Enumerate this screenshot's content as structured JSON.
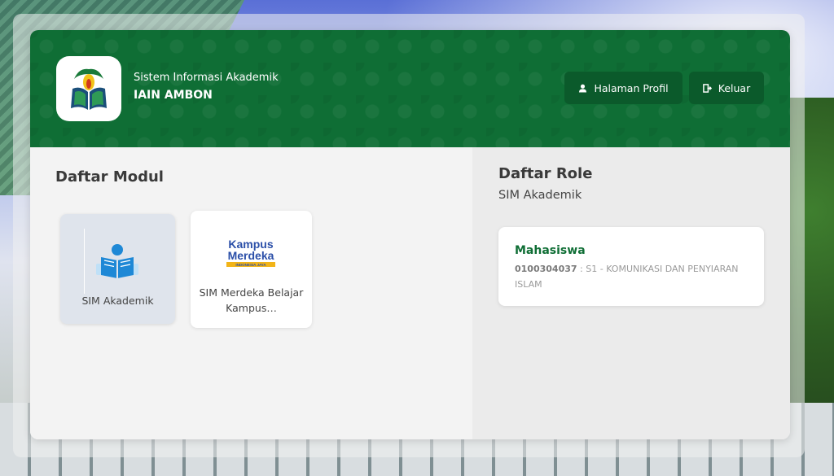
{
  "header": {
    "subtitle": "Sistem Informasi Akademik",
    "title": "IAIN AMBON",
    "profile_button": "Halaman Profil",
    "logout_button": "Keluar",
    "accent_color": "#0f6e35"
  },
  "modules": {
    "title": "Daftar Modul",
    "items": [
      {
        "label": "SIM Akademik",
        "icon": "reading-student-icon"
      },
      {
        "label": "SIM Merdeka Belajar Kampus…",
        "icon": "kampus-merdeka-logo"
      }
    ],
    "logo_text_line1": "Kampus",
    "logo_text_line2": "Merdeka",
    "logo_text_small": "INDONESIA JAYA"
  },
  "roles": {
    "title": "Daftar Role",
    "subtitle": "SIM Akademik",
    "items": [
      {
        "name": "Mahasiswa",
        "nim": "0100304037",
        "program": " : S1 - KOMUNIKASI DAN PENYIARAN ISLAM"
      }
    ]
  }
}
